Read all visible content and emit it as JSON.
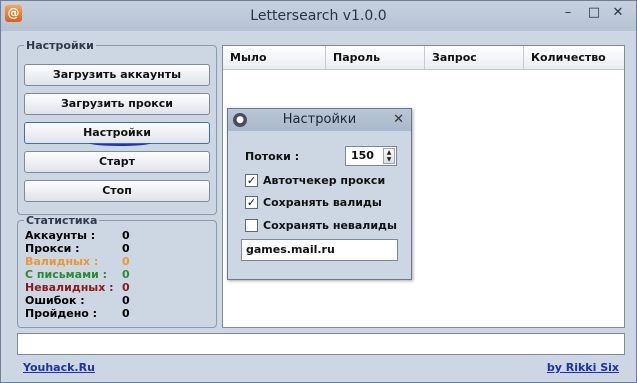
{
  "window": {
    "title": "Lettersearch v1.0.0",
    "icon_glyph": "@",
    "minimize": "–",
    "maximize": "□",
    "close": "✕"
  },
  "settings_group": {
    "legend": "Настройки",
    "buttons": {
      "load_accounts": "Загрузить аккаунты",
      "load_proxies": "Загрузить прокси",
      "settings": "Настройки",
      "start": "Старт",
      "stop": "Стоп"
    }
  },
  "stats_group": {
    "legend": "Статистика",
    "rows": [
      {
        "label": "Аккаунты :",
        "value": "0",
        "color": "#000000"
      },
      {
        "label": "Прокси :",
        "value": "0",
        "color": "#000000"
      },
      {
        "label": "Валидных :",
        "value": "0",
        "color": "#f0962c"
      },
      {
        "label": "С письмами :",
        "value": "0",
        "color": "#2e8a2e"
      },
      {
        "label": "Невалидных :",
        "value": "0",
        "color": "#8b1a1a"
      },
      {
        "label": "Ошибок :",
        "value": "0",
        "color": "#000000"
      },
      {
        "label": "Пройдено :",
        "value": "0",
        "color": "#000000"
      }
    ]
  },
  "table": {
    "columns": [
      "Мыло",
      "Пароль",
      "Запрос",
      "Количество"
    ]
  },
  "footer": {
    "left_link": "Youhack.Ru",
    "right_link": "by Rikki Six"
  },
  "dialog": {
    "title": "Настройки",
    "close": "✕",
    "threads_label": "Потоки :",
    "threads_value": "150",
    "checkboxes": [
      {
        "label": "Автотчекер прокси",
        "checked": true
      },
      {
        "label": "Сохранять валиды",
        "checked": true
      },
      {
        "label": "Сохранять невалиды",
        "checked": false
      }
    ],
    "domain_value": "games.mail.ru"
  }
}
